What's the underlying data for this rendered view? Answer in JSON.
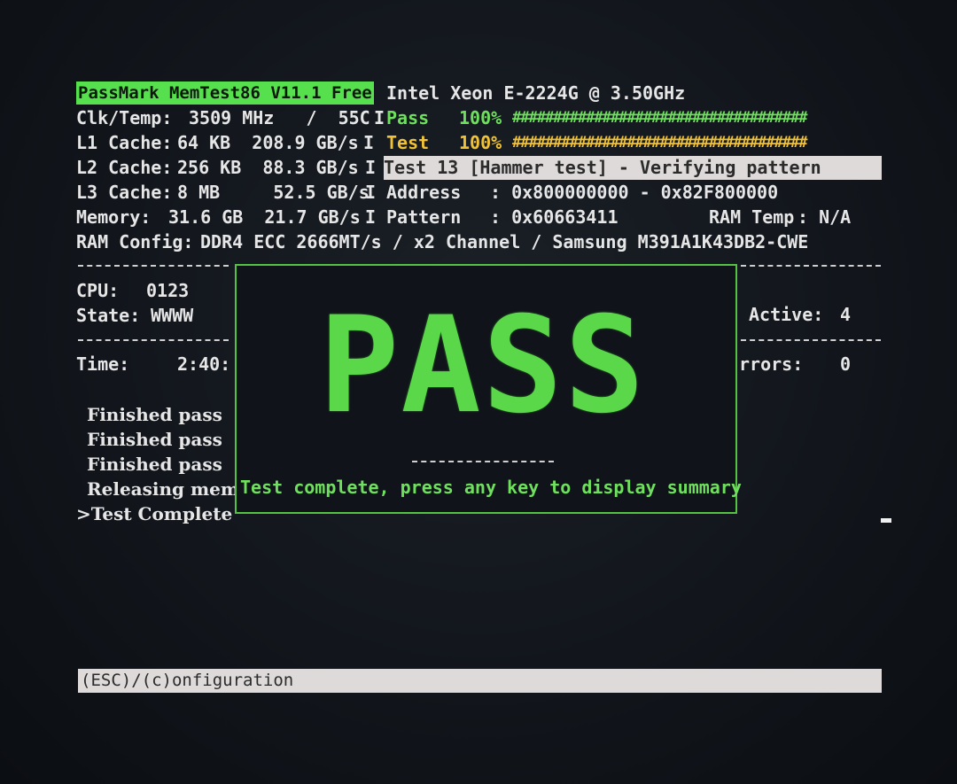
{
  "header": {
    "app_title": "PassMark MemTest86 V11.1 Free",
    "cpu_model": "Intel Xeon E-2224G @ 3.50GHz"
  },
  "stats": {
    "clk_temp_label": "Clk/Temp:",
    "clk_temp_value": "3509 MHz   /  55C",
    "l1_label": "L1 Cache:",
    "l1_value": "64 KB  208.9 GB/s",
    "l2_label": "L2 Cache:",
    "l2_value": "256 KB  88.3 GB/s",
    "l3_label": "L3 Cache:",
    "l3_value": "8 MB     52.5 GB/s",
    "memory_label": "Memory:",
    "memory_value": "31.6 GB  21.7 GB/s",
    "ram_config_label": "RAM Config:",
    "ram_config_value": "DDR4 ECC 2666MT/s / x2 Channel / Samsung M391A1K43DB2-CWE"
  },
  "progress": {
    "pass_label": "Pass",
    "pass_percent": "100%",
    "pass_bar": "####################################",
    "test_label": "Test",
    "test_percent": "100%",
    "test_bar": "####################################",
    "pass_fraction": 1.0,
    "test_fraction": 1.0
  },
  "test_info": {
    "current_test": "Test 13 [Hammer test] - Verifying pattern",
    "address_label": "Address",
    "address_value": ": 0x800000000 - 0x82F800000",
    "pattern_label": "Pattern",
    "pattern_value": ": 0x60663411",
    "ram_temp_label": "RAM Temp",
    "ram_temp_value": ": N/A"
  },
  "cpu_state": {
    "cpu_label": "CPU:",
    "cpu_value": "0123",
    "state_label": "State:",
    "state_value": "WWWW",
    "active_label": "Active:",
    "active_value": "4",
    "time_label": "Time:",
    "time_value": "2:40:",
    "errors_label": "rrors:",
    "errors_value": "0"
  },
  "log": [
    "Finished pass",
    "Finished pass",
    "Finished pass",
    "Releasing memo",
    ">Test Complete"
  ],
  "result": {
    "word": "PASS",
    "message": "Test complete, press any key to display summary"
  },
  "footer": {
    "text": "(ESC)/(c)onfiguration"
  },
  "colors": {
    "accent_green": "#57e04e",
    "accent_yellow": "#f0c237",
    "highlight_bg": "#dedad9"
  }
}
